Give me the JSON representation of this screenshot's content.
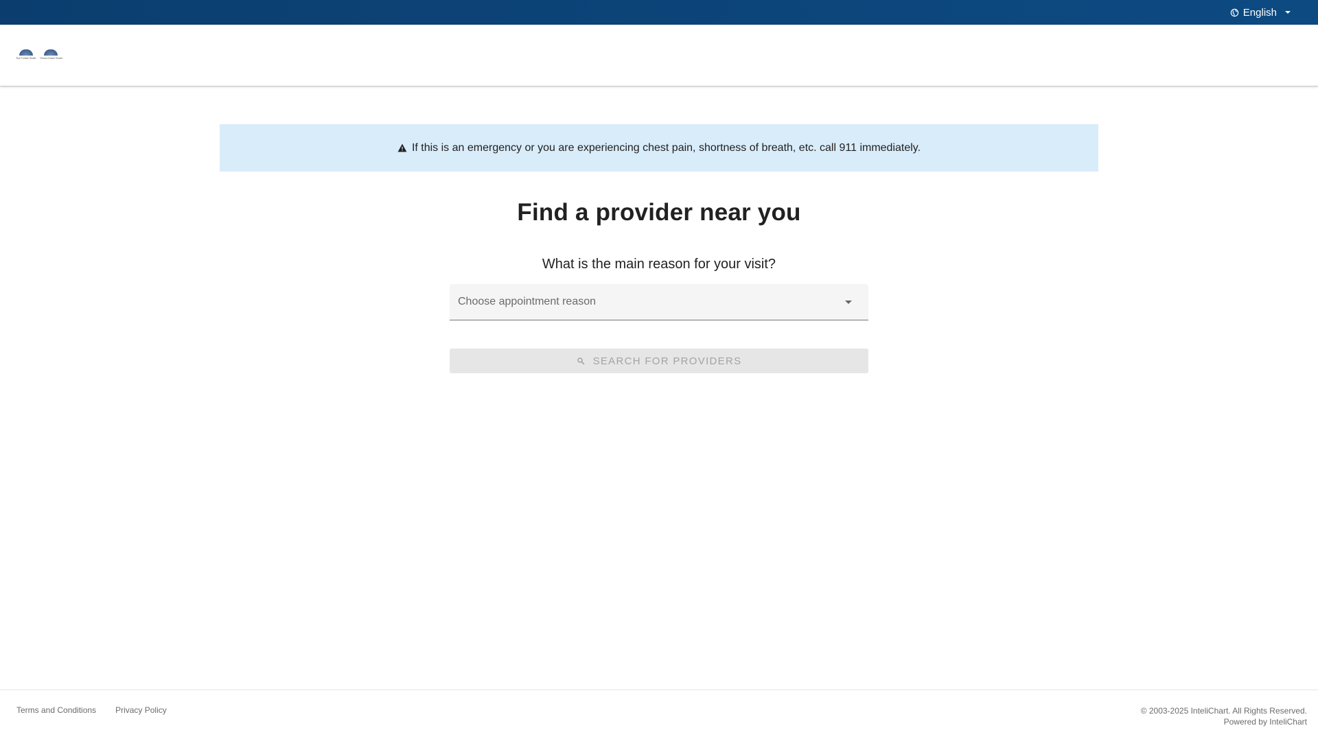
{
  "topbar": {
    "language_label": "English",
    "globe_icon": "globe-icon"
  },
  "header": {
    "logo_left_text": "Eye Center South",
    "logo_right_text": "Vision Center South"
  },
  "alert": {
    "icon": "warning-icon",
    "message": "If this is an emergency or you are experiencing chest pain, shortness of breath, etc. call 911 immediately.",
    "background": "#d9ecfa"
  },
  "main": {
    "title": "Find a provider near you",
    "question": "What is the main reason for your visit?",
    "reason_select": {
      "placeholder": "Choose appointment reason"
    },
    "search_button_label": "SEARCH FOR PROVIDERS"
  },
  "footer": {
    "terms_label": "Terms and Conditions",
    "privacy_label": "Privacy Policy",
    "copyright": "© 2003-2025 InteliChart. All Rights Reserved.",
    "powered_by": "Powered by InteliChart"
  },
  "colors": {
    "topbar": "#0d4a82",
    "button_disabled": "#e6e6e6"
  }
}
